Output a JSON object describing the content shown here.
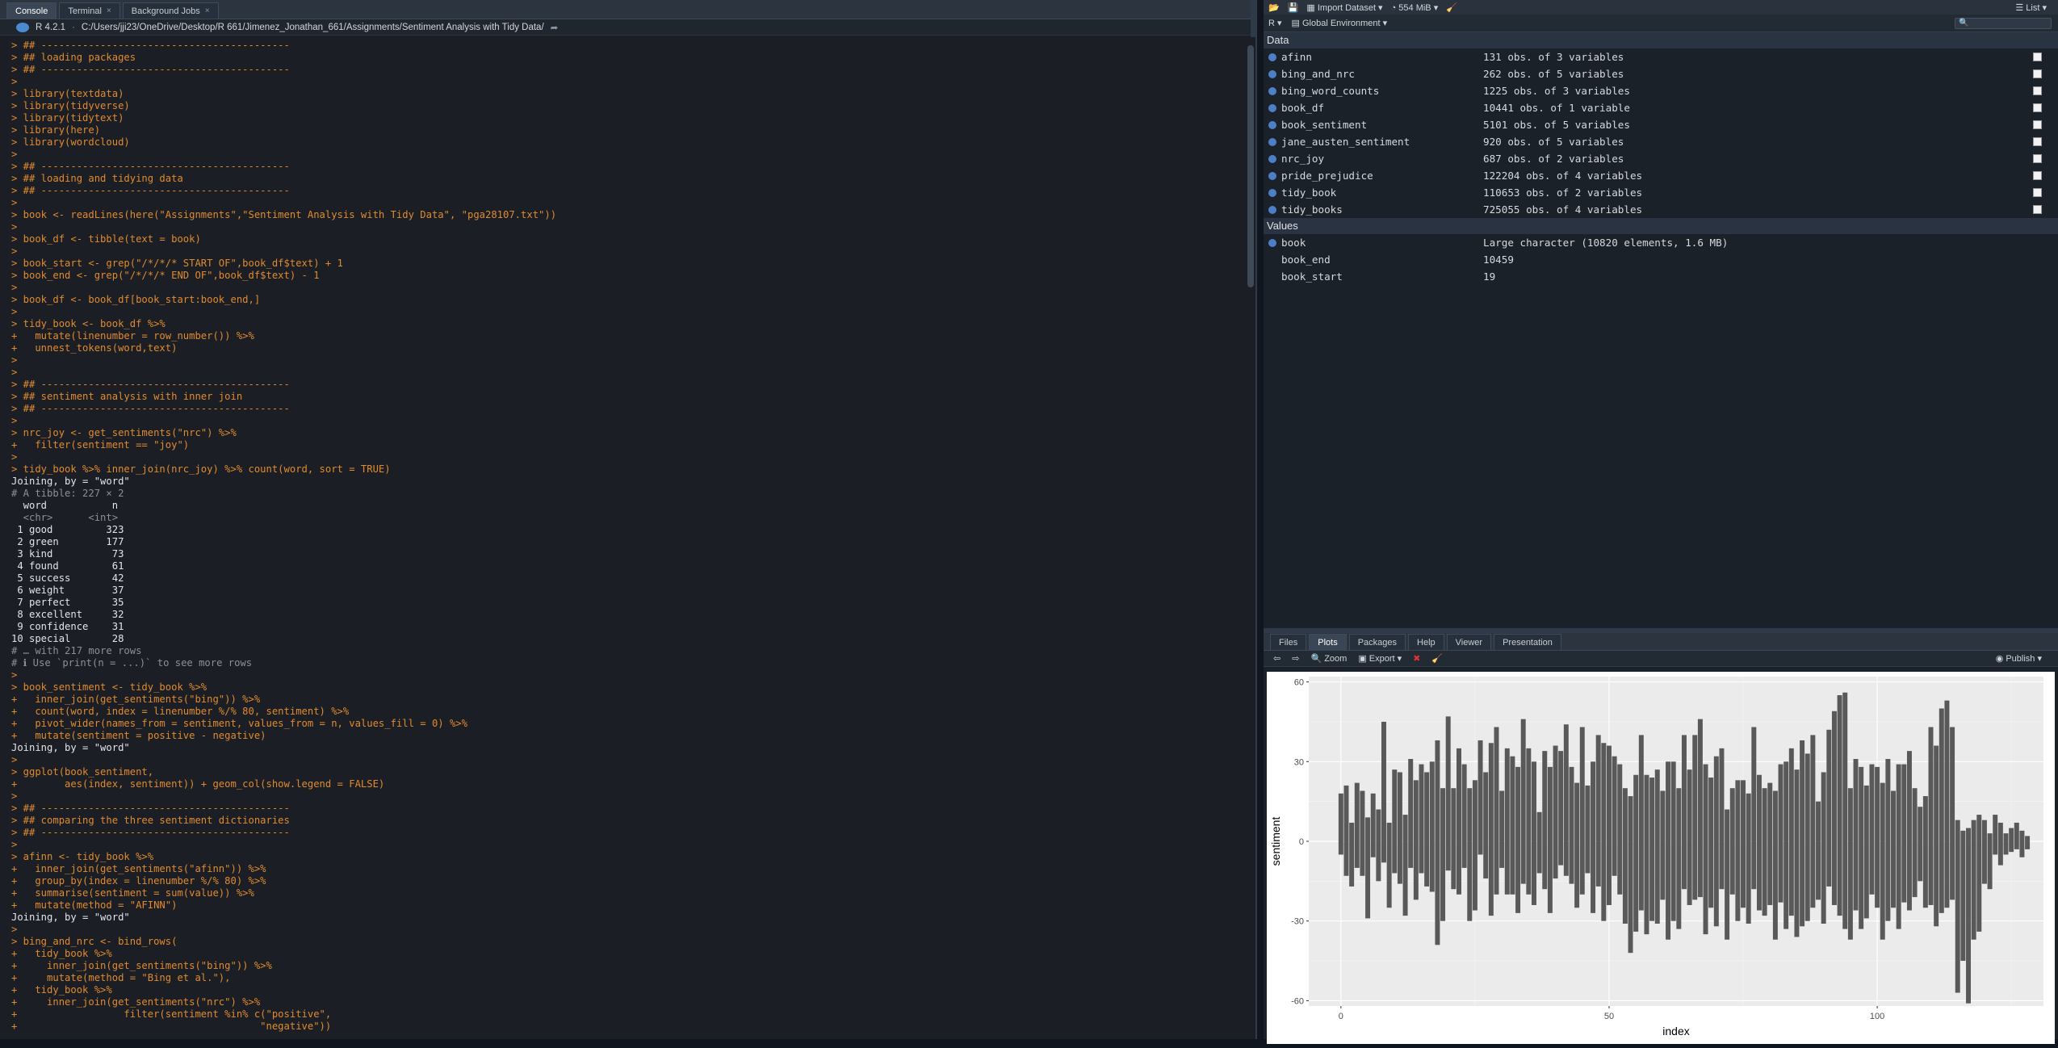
{
  "left_tabs": [
    {
      "label": "Console"
    },
    {
      "label": "Terminal"
    },
    {
      "label": "Background Jobs"
    }
  ],
  "path": {
    "r_version": "R 4.2.1",
    "dir": "C:/Users/jji23/OneDrive/Desktop/R 661/Jimenez_Jonathan_661/Assignments/Sentiment Analysis with Tidy Data/"
  },
  "console_lines": [
    {
      "t": "> ## ------------------------------------------",
      "c": "in"
    },
    {
      "t": "> ## loading packages",
      "c": "in"
    },
    {
      "t": "> ## ------------------------------------------",
      "c": "in"
    },
    {
      "t": ">",
      "c": "in"
    },
    {
      "t": "> library(textdata)",
      "c": "in"
    },
    {
      "t": "> library(tidyverse)",
      "c": "in"
    },
    {
      "t": "> library(tidytext)",
      "c": "in"
    },
    {
      "t": "> library(here)",
      "c": "in"
    },
    {
      "t": "> library(wordcloud)",
      "c": "in"
    },
    {
      "t": ">",
      "c": "in"
    },
    {
      "t": "> ## ------------------------------------------",
      "c": "in"
    },
    {
      "t": "> ## loading and tidying data",
      "c": "in"
    },
    {
      "t": "> ## ------------------------------------------",
      "c": "in"
    },
    {
      "t": ">",
      "c": "in"
    },
    {
      "t": "> book <- readLines(here(\"Assignments\",\"Sentiment Analysis with Tidy Data\", \"pga28107.txt\"))",
      "c": "in"
    },
    {
      "t": ">",
      "c": "in"
    },
    {
      "t": "> book_df <- tibble(text = book)",
      "c": "in"
    },
    {
      "t": ">",
      "c": "in"
    },
    {
      "t": "> book_start <- grep(\"/*/*/* START OF\",book_df$text) + 1",
      "c": "in"
    },
    {
      "t": "> book_end <- grep(\"/*/*/* END OF\",book_df$text) - 1",
      "c": "in"
    },
    {
      "t": ">",
      "c": "in"
    },
    {
      "t": "> book_df <- book_df[book_start:book_end,]",
      "c": "in"
    },
    {
      "t": ">",
      "c": "in"
    },
    {
      "t": "> tidy_book <- book_df %>%",
      "c": "in"
    },
    {
      "t": "+   mutate(linenumber = row_number()) %>%",
      "c": "in"
    },
    {
      "t": "+   unnest_tokens(word,text)",
      "c": "in"
    },
    {
      "t": ">",
      "c": "in"
    },
    {
      "t": ">",
      "c": "in"
    },
    {
      "t": "> ## ------------------------------------------",
      "c": "in"
    },
    {
      "t": "> ## sentiment analysis with inner join",
      "c": "in"
    },
    {
      "t": "> ## ------------------------------------------",
      "c": "in"
    },
    {
      "t": ">",
      "c": "in"
    },
    {
      "t": "> nrc_joy <- get_sentiments(\"nrc\") %>%",
      "c": "in"
    },
    {
      "t": "+   filter(sentiment == \"joy\")",
      "c": "in"
    },
    {
      "t": ">",
      "c": "in"
    },
    {
      "t": "> tidy_book %>% inner_join(nrc_joy) %>% count(word, sort = TRUE)",
      "c": "in"
    },
    {
      "t": "Joining, by = \"word\"",
      "c": "out"
    },
    {
      "t": "# A tibble: 227 × 2",
      "c": "com"
    },
    {
      "t": "  word           n",
      "c": "out"
    },
    {
      "t": "  <chr>      <int>",
      "c": "com"
    },
    {
      "t": " 1 good         323",
      "c": "out"
    },
    {
      "t": " 2 green        177",
      "c": "out"
    },
    {
      "t": " 3 kind          73",
      "c": "out"
    },
    {
      "t": " 4 found         61",
      "c": "out"
    },
    {
      "t": " 5 success       42",
      "c": "out"
    },
    {
      "t": " 6 weight        37",
      "c": "out"
    },
    {
      "t": " 7 perfect       35",
      "c": "out"
    },
    {
      "t": " 8 excellent     32",
      "c": "out"
    },
    {
      "t": " 9 confidence    31",
      "c": "out"
    },
    {
      "t": "10 special       28",
      "c": "out"
    },
    {
      "t": "# … with 217 more rows",
      "c": "com"
    },
    {
      "t": "# ℹ Use `print(n = ...)` to see more rows",
      "c": "com"
    },
    {
      "t": ">",
      "c": "in"
    },
    {
      "t": "> book_sentiment <- tidy_book %>%",
      "c": "in"
    },
    {
      "t": "+   inner_join(get_sentiments(\"bing\")) %>%",
      "c": "in"
    },
    {
      "t": "+   count(word, index = linenumber %/% 80, sentiment) %>%",
      "c": "in"
    },
    {
      "t": "+   pivot_wider(names_from = sentiment, values_from = n, values_fill = 0) %>%",
      "c": "in"
    },
    {
      "t": "+   mutate(sentiment = positive - negative)",
      "c": "in"
    },
    {
      "t": "Joining, by = \"word\"",
      "c": "out"
    },
    {
      "t": ">",
      "c": "in"
    },
    {
      "t": "> ggplot(book_sentiment,",
      "c": "in"
    },
    {
      "t": "+        aes(index, sentiment)) + geom_col(show.legend = FALSE)",
      "c": "in"
    },
    {
      "t": ">",
      "c": "in"
    },
    {
      "t": "> ## ------------------------------------------",
      "c": "in"
    },
    {
      "t": "> ## comparing the three sentiment dictionaries",
      "c": "in"
    },
    {
      "t": "> ## ------------------------------------------",
      "c": "in"
    },
    {
      "t": ">",
      "c": "in"
    },
    {
      "t": "> afinn <- tidy_book %>%",
      "c": "in"
    },
    {
      "t": "+   inner_join(get_sentiments(\"afinn\")) %>%",
      "c": "in"
    },
    {
      "t": "+   group_by(index = linenumber %/% 80) %>%",
      "c": "in"
    },
    {
      "t": "+   summarise(sentiment = sum(value)) %>%",
      "c": "in"
    },
    {
      "t": "+   mutate(method = \"AFINN\")",
      "c": "in"
    },
    {
      "t": "Joining, by = \"word\"",
      "c": "out"
    },
    {
      "t": ">",
      "c": "in"
    },
    {
      "t": "> bing_and_nrc <- bind_rows(",
      "c": "in"
    },
    {
      "t": "+   tidy_book %>%",
      "c": "in"
    },
    {
      "t": "+     inner_join(get_sentiments(\"bing\")) %>%",
      "c": "in"
    },
    {
      "t": "+     mutate(method = \"Bing et al.\"),",
      "c": "in"
    },
    {
      "t": "+   tidy_book %>%",
      "c": "in"
    },
    {
      "t": "+     inner_join(get_sentiments(\"nrc\") %>%",
      "c": "in"
    },
    {
      "t": "+                  filter(sentiment %in% c(\"positive\",",
      "c": "in"
    },
    {
      "t": "+                                         \"negative\"))",
      "c": "in"
    }
  ],
  "env_toolbar": {
    "import": "Import Dataset",
    "mem": "554 MiB",
    "view": "List",
    "lang": "R",
    "env": "Global Environment"
  },
  "data_header": "Data",
  "data_rows": [
    {
      "name": "afinn",
      "val": "131 obs. of 3 variables"
    },
    {
      "name": "bing_and_nrc",
      "val": "262 obs. of 5 variables"
    },
    {
      "name": "bing_word_counts",
      "val": "1225 obs. of 3 variables"
    },
    {
      "name": "book_df",
      "val": "10441 obs. of 1 variable"
    },
    {
      "name": "book_sentiment",
      "val": "5101 obs. of 5 variables"
    },
    {
      "name": "jane_austen_sentiment",
      "val": "920 obs. of 5 variables"
    },
    {
      "name": "nrc_joy",
      "val": "687 obs. of 2 variables"
    },
    {
      "name": "pride_prejudice",
      "val": "122204 obs. of 4 variables"
    },
    {
      "name": "tidy_book",
      "val": "110653 obs. of 2 variables"
    },
    {
      "name": "tidy_books",
      "val": "725055 obs. of 4 variables"
    }
  ],
  "values_header": "Values",
  "value_rows": [
    {
      "name": "book",
      "val": "Large character (10820 elements,  1.6 MB)",
      "icon": true
    },
    {
      "name": "book_end",
      "val": "10459",
      "icon": false
    },
    {
      "name": "book_start",
      "val": "19",
      "icon": false
    }
  ],
  "lower_tabs": [
    {
      "label": "Files"
    },
    {
      "label": "Plots"
    },
    {
      "label": "Packages"
    },
    {
      "label": "Help"
    },
    {
      "label": "Viewer"
    },
    {
      "label": "Presentation"
    }
  ],
  "plot_toolbar": {
    "zoom": "Zoom",
    "export": "Export",
    "publish": "Publish"
  },
  "colors": {
    "console_input": "#e08a2e",
    "bar_fill": "#595959",
    "panel_bg": "#ebebeb"
  },
  "chart_data": {
    "type": "bar",
    "xlabel": "index",
    "ylabel": "sentiment",
    "xlim": [
      -6,
      131
    ],
    "ylim": [
      -62,
      62
    ],
    "xticks": [
      0,
      50,
      100
    ],
    "yticks": [
      -60,
      -30,
      0,
      30,
      60
    ],
    "x": [
      0,
      1,
      2,
      3,
      4,
      5,
      6,
      7,
      8,
      9,
      10,
      11,
      12,
      13,
      14,
      15,
      16,
      17,
      18,
      19,
      20,
      21,
      22,
      23,
      24,
      25,
      26,
      27,
      28,
      29,
      30,
      31,
      32,
      33,
      34,
      35,
      36,
      37,
      38,
      39,
      40,
      41,
      42,
      43,
      44,
      45,
      46,
      47,
      48,
      49,
      50,
      51,
      52,
      53,
      54,
      55,
      56,
      57,
      58,
      59,
      60,
      61,
      62,
      63,
      64,
      65,
      66,
      67,
      68,
      69,
      70,
      71,
      72,
      73,
      74,
      75,
      76,
      77,
      78,
      79,
      80,
      81,
      82,
      83,
      84,
      85,
      86,
      87,
      88,
      89,
      90,
      91,
      92,
      93,
      94,
      95,
      96,
      97,
      98,
      99,
      100,
      101,
      102,
      103,
      104,
      105,
      106,
      107,
      108,
      109,
      110,
      111,
      112,
      113,
      114,
      115,
      116,
      117,
      118,
      119,
      120,
      121,
      122,
      123,
      124,
      125,
      126,
      127,
      128
    ],
    "pos": [
      18,
      21,
      7,
      22,
      19,
      9,
      18,
      12,
      45,
      7,
      27,
      26,
      10,
      31,
      23,
      29,
      26,
      30,
      38,
      20,
      47,
      20,
      35,
      29,
      20,
      23,
      38,
      26,
      37,
      43,
      19,
      35,
      32,
      28,
      46,
      35,
      30,
      11,
      34,
      28,
      36,
      34,
      44,
      28,
      22,
      43,
      21,
      30,
      40,
      37,
      36,
      32,
      29,
      20,
      17,
      25,
      40,
      25,
      24,
      27,
      19,
      30,
      30,
      20,
      40,
      27,
      40,
      46,
      29,
      24,
      32,
      35,
      12,
      20,
      23,
      23,
      18,
      43,
      25,
      20,
      22,
      19,
      29,
      30,
      35,
      27,
      38,
      33,
      40,
      15,
      26,
      42,
      49,
      55,
      56,
      20,
      31,
      28,
      21,
      29,
      28,
      22,
      31,
      19,
      29,
      29,
      34,
      20,
      13,
      17,
      43,
      36,
      50,
      53,
      43,
      8,
      4,
      5,
      8,
      10,
      8,
      3,
      10,
      7,
      3,
      5,
      7,
      4,
      2
    ],
    "neg": [
      -5,
      -13,
      -17,
      -10,
      -13,
      -29,
      -6,
      -15,
      -8,
      -25,
      -12,
      -16,
      -28,
      -10,
      -22,
      -12,
      -17,
      -19,
      -39,
      -30,
      -11,
      -18,
      -20,
      -10,
      -30,
      -26,
      -5,
      -14,
      -28,
      -20,
      -10,
      -20,
      -20,
      -27,
      -16,
      -20,
      -24,
      -12,
      -18,
      -27,
      -14,
      -9,
      -13,
      -16,
      -25,
      -20,
      -12,
      -27,
      -17,
      -30,
      -24,
      -13,
      -20,
      -31,
      -42,
      -34,
      -26,
      -35,
      -30,
      -31,
      -22,
      -37,
      -30,
      -33,
      -18,
      -24,
      -22,
      -21,
      -35,
      -25,
      -32,
      -18,
      -37,
      -20,
      -30,
      -25,
      -31,
      -18,
      -26,
      -28,
      -24,
      -37,
      -23,
      -33,
      -28,
      -36,
      -32,
      -30,
      -25,
      -22,
      -31,
      -17,
      -24,
      -28,
      -33,
      -37,
      -26,
      -33,
      -29,
      -20,
      -25,
      -37,
      -30,
      -25,
      -33,
      -23,
      -26,
      -21,
      -15,
      -25,
      -24,
      -32,
      -27,
      -25,
      -22,
      -57,
      -45,
      -61,
      -37,
      -34,
      -16,
      -18,
      -5,
      -9,
      -5,
      -4,
      -3,
      -6,
      -3
    ]
  }
}
